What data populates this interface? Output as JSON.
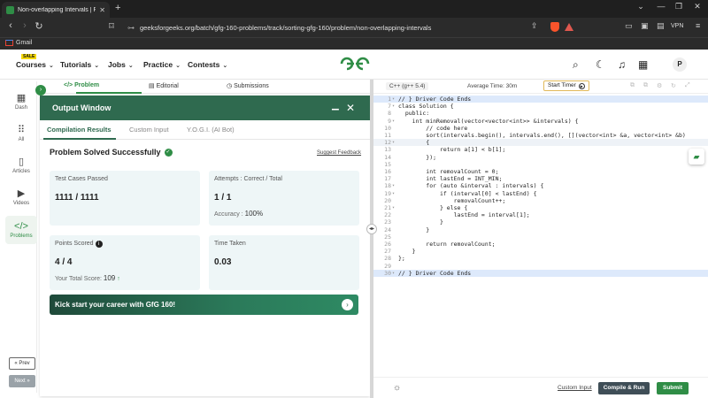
{
  "browser": {
    "tab_title": "Non-overlapping Intervals | Pra",
    "url": "geeksforgeeks.org/batch/gfg-160-problems/track/sorting-gfg-160/problem/non-overlapping-intervals",
    "vpn_label": "VPN",
    "bookmark_gmail": "Gmail"
  },
  "header": {
    "sale_badge": "SALE",
    "menu": [
      "Courses",
      "Tutorials",
      "Jobs",
      "Practice",
      "Contests"
    ],
    "avatar_letter": "P"
  },
  "rail": {
    "items": [
      "Dash",
      "All",
      "Articles",
      "Videos",
      "Problems"
    ],
    "prev_label": "« Prev",
    "next_label": "Next »"
  },
  "problem_tabs": [
    "Problem",
    "Editorial",
    "Submissions"
  ],
  "output": {
    "title": "Output Window",
    "tabs": [
      "Compilation Results",
      "Custom Input",
      "Y.O.G.I. (AI Bot)"
    ],
    "status": "Problem Solved Successfully",
    "feedback_link": "Suggest Feedback",
    "test_cases_label": "Test Cases Passed",
    "test_cases_value": "1111 / 1111",
    "attempts_label": "Attempts : Correct / Total",
    "attempts_value": "1 / 1",
    "accuracy_label": "Accuracy :",
    "accuracy_value": "100%",
    "points_label": "Points Scored",
    "points_value": "4 / 4",
    "total_score_label": "Your Total Score:",
    "total_score_value": "109",
    "time_label": "Time Taken",
    "time_value": "0.03",
    "banner_text": "Kick start your career with GfG 160!"
  },
  "editor": {
    "language": "C++ (g++ 5.4)",
    "avg_time": "Average Time: 30m",
    "timer_label": "Start Timer",
    "custom_input": "Custom Input",
    "compile_label": "Compile & Run",
    "submit_label": "Submit",
    "lines": [
      {
        "n": "1",
        "fold": true,
        "text": "// } Driver Code Ends",
        "type": "hl"
      },
      {
        "n": "7",
        "fold": true,
        "text": "class Solution {"
      },
      {
        "n": "8",
        "text": "  public:"
      },
      {
        "n": "9",
        "fold": true,
        "text": "    int minRemoval(vector<vector<int>> &intervals) {"
      },
      {
        "n": "10",
        "text": "        // code here"
      },
      {
        "n": "11",
        "text": "        sort(intervals.begin(), intervals.end(), [](vector<int> &a, vector<int> &b)"
      },
      {
        "n": "12",
        "fold": true,
        "text": "        {",
        "type": "cur"
      },
      {
        "n": "13",
        "text": "            return a[1] < b[1];"
      },
      {
        "n": "14",
        "text": "        });"
      },
      {
        "n": "15",
        "text": ""
      },
      {
        "n": "16",
        "text": "        int removalCount = 0;"
      },
      {
        "n": "17",
        "text": "        int lastEnd = INT_MIN;"
      },
      {
        "n": "18",
        "fold": true,
        "text": "        for (auto &interval : intervals) {"
      },
      {
        "n": "19",
        "fold": true,
        "text": "            if (interval[0] < lastEnd) {"
      },
      {
        "n": "20",
        "text": "                removalCount++;"
      },
      {
        "n": "21",
        "fold": true,
        "text": "            } else {"
      },
      {
        "n": "22",
        "text": "                lastEnd = interval[1];"
      },
      {
        "n": "23",
        "text": "            }"
      },
      {
        "n": "24",
        "text": "        }"
      },
      {
        "n": "25",
        "text": ""
      },
      {
        "n": "26",
        "text": "        return removalCount;"
      },
      {
        "n": "27",
        "text": "    }"
      },
      {
        "n": "28",
        "text": "};"
      },
      {
        "n": "29",
        "text": ""
      },
      {
        "n": "30",
        "fold": true,
        "text": "// } Driver Code Ends",
        "type": "hl"
      }
    ]
  },
  "colors": {
    "brand_green": "#2f8d46",
    "output_header": "#2f6a4f",
    "card_bg": "#eef6f7"
  }
}
